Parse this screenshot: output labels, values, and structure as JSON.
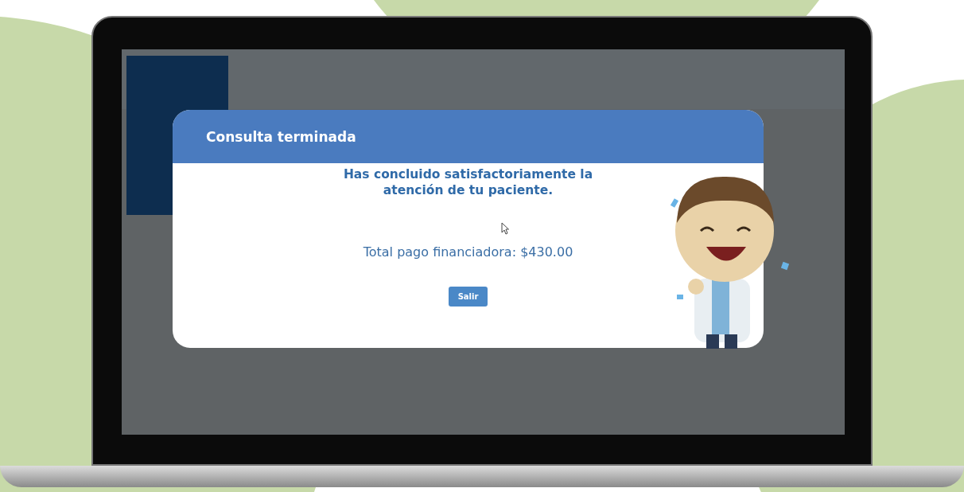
{
  "modal": {
    "title": "Consulta terminada",
    "message": "Has concluido satisfactoriamente la atención de tu paciente.",
    "total": "Total pago financiadora: $430.00",
    "buttons": [
      {
        "label": "Salir"
      }
    ]
  }
}
